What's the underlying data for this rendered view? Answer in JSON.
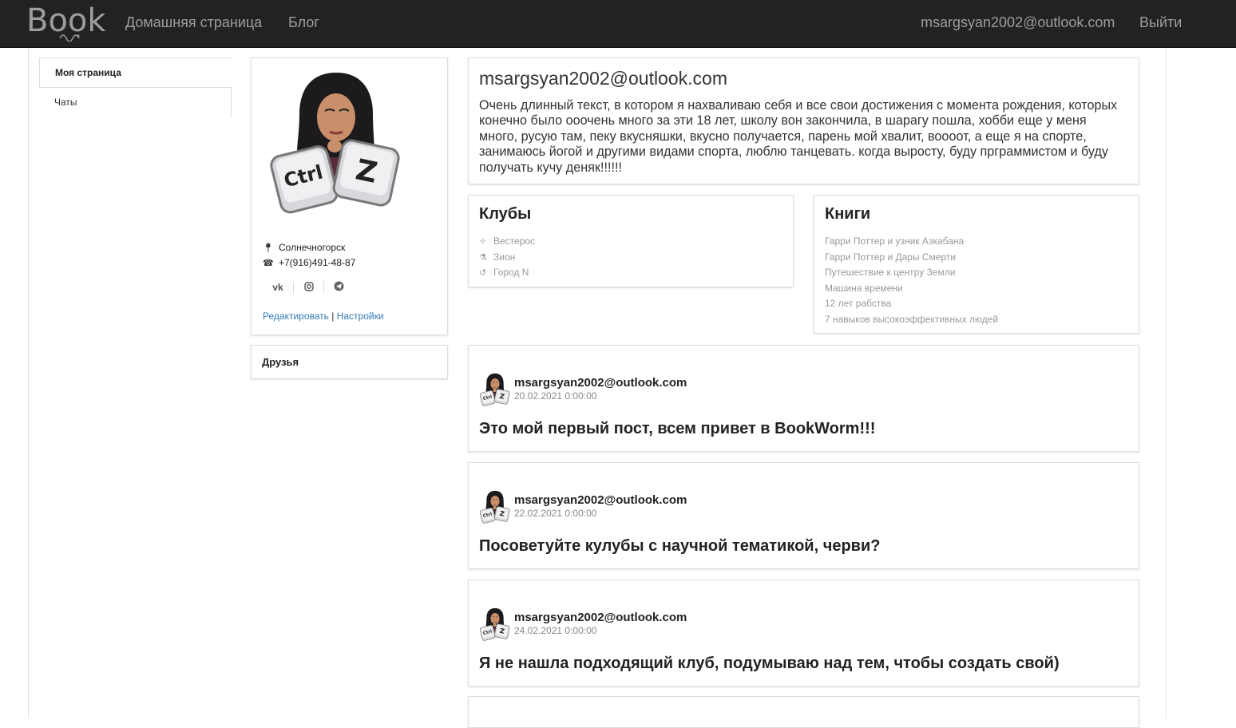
{
  "navbar": {
    "brand": "Book",
    "home": "Домашняя страница",
    "blog": "Блог",
    "user_email": "msargsyan2002@outlook.com",
    "logout": "Выйти"
  },
  "menu": {
    "items": [
      {
        "label": "Моя страница",
        "active": true
      },
      {
        "label": "Чаты",
        "active": false
      }
    ]
  },
  "profile": {
    "city": "Солнечногорск",
    "phone": "+7(916)491-48-87",
    "socials": [
      "vk-icon",
      "instagram-icon",
      "telegram-icon"
    ],
    "edit_label": "Редактировать",
    "separator": "|",
    "settings_label": "Настройки"
  },
  "friends": {
    "title": "Друзья"
  },
  "about": {
    "title": "msargsyan2002@outlook.com",
    "text": "Очень длинный текст, в котором я нахваливаю себя и все свои достижения с момента рождения, которых конечно было ооочень много за эти 18 лет, школу вон закончила, в шарагу пошла, хобби еще у меня много, русую там, пеку вкусняшки, вкусно получается, парень мой хвалит, воооот, а еще я на спорте, занимаюсь йогой и другими видами спорта, люблю танцевать. когда выросту, буду прграммистом и буду получать кучу деняк!!!!!!"
  },
  "clubs": {
    "title": "Клубы",
    "items": [
      {
        "icon": "magic-wand-icon",
        "label": "Вестерос"
      },
      {
        "icon": "flask-icon",
        "label": "Зион"
      },
      {
        "icon": "history-icon",
        "label": "Город N"
      }
    ]
  },
  "books": {
    "title": "Книги",
    "items": [
      "Гарри Поттер и узник Азкабана",
      "Гарри Поттер и Дары Смерти",
      "Путешествие к центру Земли",
      "Машина времени",
      "12 лет рабства",
      "7 навыков высокоэффективных людей"
    ]
  },
  "posts": [
    {
      "author": "msargsyan2002@outlook.com",
      "date": "20.02.2021 0:00:00",
      "text": "Это мой первый пост, всем привет в BookWorm!!!"
    },
    {
      "author": "msargsyan2002@outlook.com",
      "date": "22.02.2021 0:00:00",
      "text": "Посоветуйте кулубы с научной тематикой, черви?"
    },
    {
      "author": "msargsyan2002@outlook.com",
      "date": "24.02.2021 0:00:00",
      "text": "Я не нашла подходящий клуб, подумываю над тем, чтобы создать свой)"
    }
  ]
}
